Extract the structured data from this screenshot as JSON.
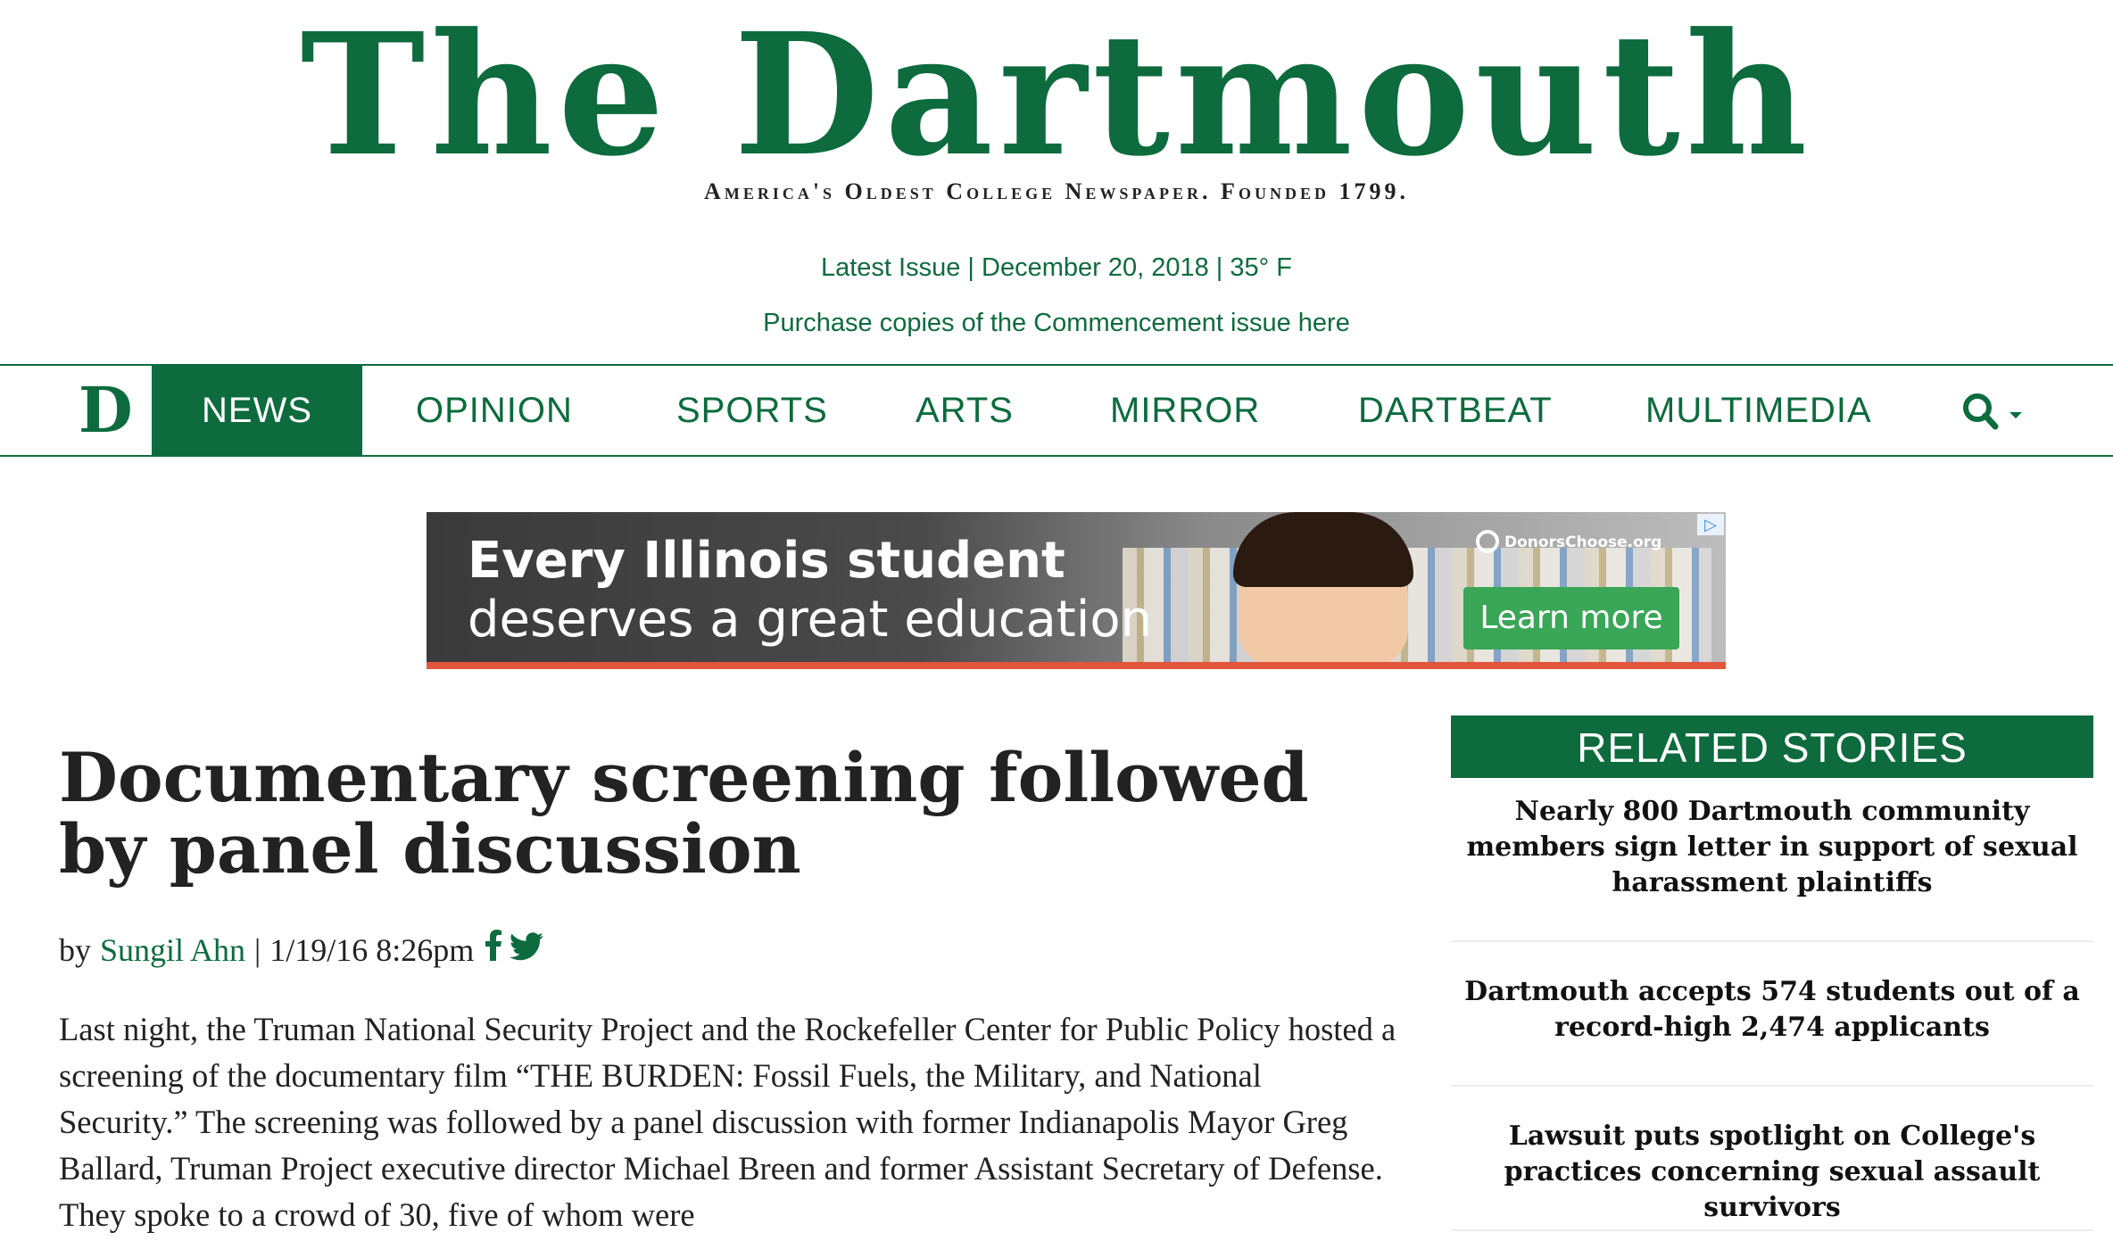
{
  "masthead": {
    "logo": "The Dartmouth",
    "tagline": "America's Oldest College Newspaper. Founded 1799.",
    "latest_issue": "Latest Issue",
    "date": "December 20, 2018",
    "temperature": "35° F",
    "purchase_link": "Purchase copies of the Commencement issue here"
  },
  "nav": {
    "logo_glyph": "D",
    "items": [
      {
        "label": "NEWS",
        "active": true
      },
      {
        "label": "OPINION",
        "active": false
      },
      {
        "label": "SPORTS",
        "active": false
      },
      {
        "label": "ARTS",
        "active": false
      },
      {
        "label": "MIRROR",
        "active": false
      },
      {
        "label": "DARTBEAT",
        "active": false
      },
      {
        "label": "MULTIMEDIA",
        "active": false
      }
    ],
    "search_icon": "search-icon"
  },
  "ad": {
    "line1": "Every Illinois student",
    "line2": "deserves a great education",
    "cta": "Learn more",
    "brand": "DonorsChoose.org",
    "choices_glyph": "▷"
  },
  "article": {
    "headline": "Documentary screening followed by panel discussion",
    "by": "by",
    "author": "Sungil Ahn",
    "separator": "|",
    "timestamp": "1/19/16 8:26pm",
    "share_icons": [
      "facebook-icon",
      "twitter-icon"
    ],
    "body": "Last night, the Truman National Security Project and the Rockefeller Center for Public Policy hosted a screening of the documentary film “THE BURDEN: Fossil Fuels, the Military, and National Security.” The screening was followed by a panel discussion with former Indianapolis Mayor Greg Ballard, Truman Project executive director Michael Breen and former Assistant Secretary of Defense. They spoke to a crowd of 30, five of whom were"
  },
  "related": {
    "title": "RELATED STORIES",
    "items": [
      "Nearly 800 Dartmouth community members sign letter in support of sexual harassment plaintiffs",
      "Dartmouth accepts 574 students out of a record-high 2,474 applicants",
      "Lawsuit puts spotlight on College's practices concerning sexual assault survivors"
    ]
  },
  "colors": {
    "brand_green": "#0d6b3e",
    "text": "#222222",
    "ad_cta": "#3aa657"
  }
}
